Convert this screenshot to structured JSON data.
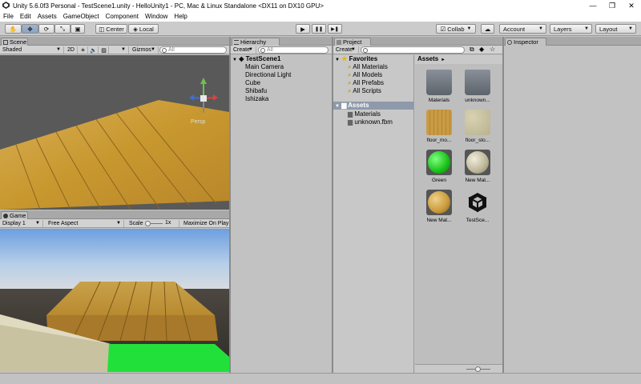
{
  "window": {
    "title": "Unity 5.6.0f3 Personal - TestScene1.unity - HelloUnity1 - PC, Mac & Linux Standalone <DX11 on DX10 GPU>",
    "minimize": "—",
    "maximize": "❐",
    "close": "✕"
  },
  "menu": [
    "File",
    "Edit",
    "Assets",
    "GameObject",
    "Component",
    "Window",
    "Help"
  ],
  "toolbar": {
    "center": "Center",
    "local": "Local",
    "collab": "Collab",
    "account": "Account",
    "layers": "Layers",
    "layout": "Layout",
    "play": "▶",
    "pause": "❚❚",
    "step": "▶❚"
  },
  "scene": {
    "tab": "Scene",
    "shading": "Shaded",
    "mode2d": "2D",
    "gizmos": "Gizmos",
    "search_placeholder": "All",
    "persp": "Persp"
  },
  "game": {
    "tab": "Game",
    "display": "Display 1",
    "aspect": "Free Aspect",
    "scale_label": "Scale",
    "scale_value": "1x",
    "maximize": "Maximize On Play"
  },
  "hierarchy": {
    "tab": "Hierarchy",
    "create": "Create",
    "search_placeholder": "All",
    "scene_name": "TestScene1",
    "items": [
      "Main Camera",
      "Directional Light",
      "Cube",
      "Shibafu",
      "Ishizaka"
    ]
  },
  "project": {
    "tab": "Project",
    "create": "Create",
    "favorites_label": "Favorites",
    "favorites": [
      "All Materials",
      "All Models",
      "All Prefabs",
      "All Scripts"
    ],
    "assets_label": "Assets",
    "asset_folders": [
      "Materials",
      "unknown.fbm"
    ],
    "breadcrumb": "Assets",
    "grid": [
      "Materials",
      "unknown...",
      "floor_mo...",
      "floor_sto...",
      "Green",
      "New Mat...",
      "New Mat...",
      "TestSce..."
    ]
  },
  "inspector": {
    "tab": "Inspector"
  },
  "colors": {
    "accent": "#3e7bd6",
    "wood": "#c89a3a",
    "grass": "#22dd22",
    "sky": "#8ab4e6"
  }
}
